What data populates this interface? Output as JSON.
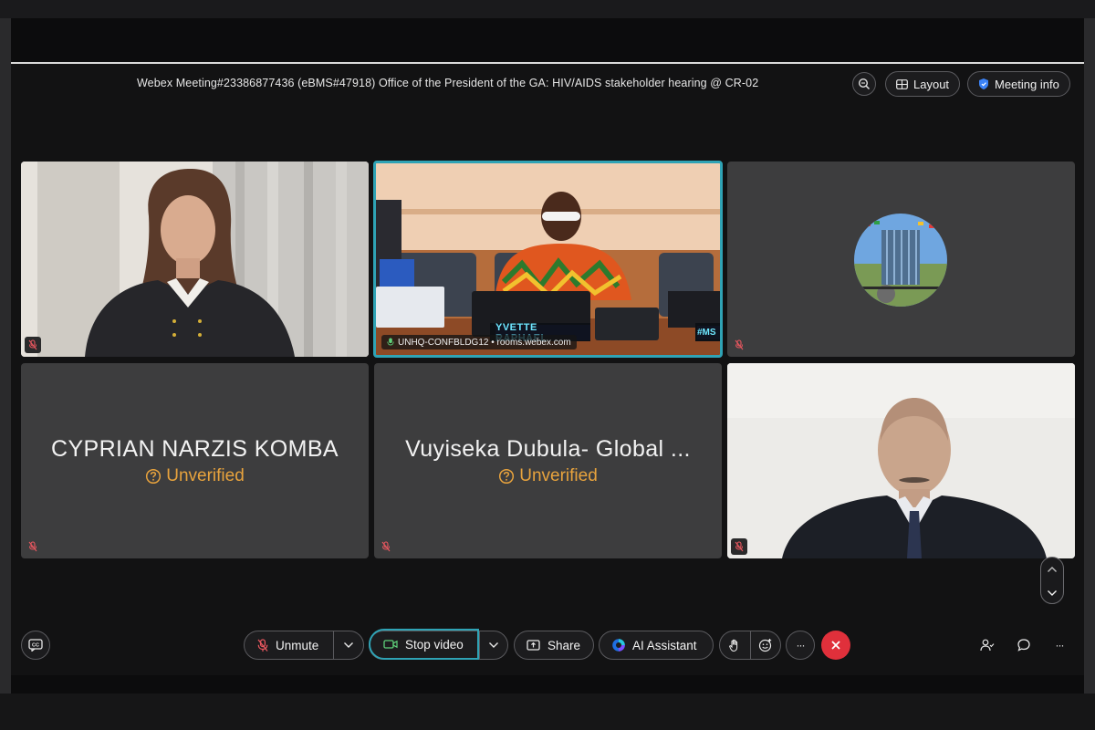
{
  "meeting": {
    "title": "Webex Meeting#23386877436 (eBMS#47918) Office of the President of the GA: HIV/AIDS stakeholder hearing @ CR-02",
    "layout_label": "Layout",
    "meeting_info_label": "Meeting info"
  },
  "tiles": {
    "room": {
      "name_tag": "UNHQ-CONFBLDG12 • rooms.webex.com",
      "nameplate": "YVETTE RAPHAEL",
      "nameplate2": "#MS"
    },
    "cyprian": {
      "name": "CYPRIAN NARZIS KOMBA",
      "status": "Unverified"
    },
    "vuyiseka": {
      "name": "Vuyiseka Dubula- Global ...",
      "status": "Unverified"
    }
  },
  "controls": {
    "unmute_label": "Unmute",
    "stop_video_label": "Stop video",
    "share_label": "Share",
    "ai_assistant_label": "AI Assistant",
    "more_label": "···",
    "end_call_color": "#e0303b",
    "accent_color": "#2fa3b5",
    "warning_color": "#e8a33d"
  }
}
